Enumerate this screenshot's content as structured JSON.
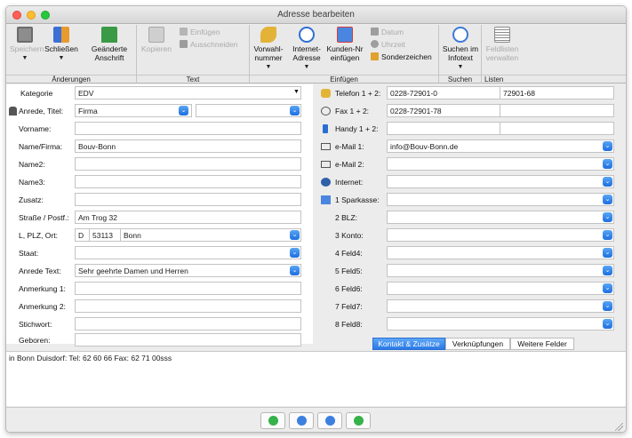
{
  "window": {
    "title": "Adresse bearbeiten"
  },
  "toolbar": {
    "groups": {
      "aenderungen": "Änderungen",
      "text": "Text",
      "einfuegen": "Einfügen",
      "suchen": "Suchen",
      "listen": "Listen"
    },
    "speichern": "Speichern",
    "schliessen": "Schließen",
    "geaenderte_anschrift_1": "Geänderte",
    "geaenderte_anschrift_2": "Anschrift",
    "kopieren": "Kopieren",
    "einfuegen_small": "Einfügen",
    "ausschneiden": "Ausschneiden",
    "vorwahlnummer_1": "Vorwahl-",
    "vorwahlnummer_2": "nummer",
    "internet_adresse_1": "Internet-",
    "internet_adresse_2": "Adresse",
    "kunden_nr_1": "Kunden-Nr",
    "kunden_nr_2": "einfügen",
    "datum": "Datum",
    "uhrzeit": "Uhrzeit",
    "sonderzeichen": "Sonderzeichen",
    "suchen_infotext_1": "Suchen im",
    "suchen_infotext_2": "Infotext",
    "feldlisten_1": "Feldlisten",
    "feldlisten_2": "verwalten"
  },
  "form": {
    "kategorie": {
      "label": "Kategorie",
      "value": "EDV"
    },
    "anrede": {
      "label": "Anrede, Titel:",
      "value": "Firma",
      "value2": ""
    },
    "vorname": {
      "label": "Vorname:",
      "value": ""
    },
    "name_firma": {
      "label": "Name/Firma:",
      "value": "Bouv-Bonn"
    },
    "name2": {
      "label": "Name2:",
      "value": ""
    },
    "name3": {
      "label": "Name3:",
      "value": ""
    },
    "zusatz": {
      "label": "Zusatz:",
      "value": ""
    },
    "strasse": {
      "label": "Straße / Postf.:",
      "value": "Am Trog 32"
    },
    "plz_ort": {
      "label": "L, PLZ, Ort:",
      "land": "D",
      "plz": "53113",
      "ort": "Bonn"
    },
    "staat": {
      "label": "Staat:",
      "value": ""
    },
    "anrede_text": {
      "label": "Anrede Text:",
      "value": "Sehr geehrte Damen und Herren"
    },
    "anmerkung1": {
      "label": "Anmerkung 1:",
      "value": ""
    },
    "anmerkung2": {
      "label": "Anmerkung 2:",
      "value": ""
    },
    "stichwort": {
      "label": "Stichwort:",
      "value": ""
    },
    "geboren": {
      "label": "Geboren:",
      "value": ""
    }
  },
  "contact": {
    "telefon": {
      "label": "Telefon 1 + 2:",
      "value1": "0228-72901-0",
      "value2": "72901-68"
    },
    "fax": {
      "label": "Fax 1 + 2:",
      "value1": "0228-72901-78",
      "value2": ""
    },
    "handy": {
      "label": "Handy 1 + 2:",
      "value1": "",
      "value2": ""
    },
    "email1": {
      "label": "e-Mail 1:",
      "value": "info@Bouv-Bonn.de"
    },
    "email2": {
      "label": "e-Mail 2:",
      "value": ""
    },
    "internet": {
      "label": "Internet:",
      "value": ""
    },
    "sparkasse": {
      "label": "1 Sparkasse:",
      "value": ""
    },
    "blz": {
      "label": "2 BLZ:",
      "value": ""
    },
    "konto": {
      "label": "3 Konto:",
      "value": ""
    },
    "feld4": {
      "label": "4 Feld4:",
      "value": ""
    },
    "feld5": {
      "label": "5 Feld5:",
      "value": ""
    },
    "feld6": {
      "label": "6 Feld6:",
      "value": ""
    },
    "feld7": {
      "label": "7 Feld7:",
      "value": ""
    },
    "feld8": {
      "label": "8 Feld8:",
      "value": ""
    }
  },
  "tabs": [
    "Kontakt & Zusätze",
    "Verknüpfungen",
    "Weitere Felder"
  ],
  "notes": {
    "text": "in Bonn Duisdorf: Tel: 62 60 66 Fax: 62 71 00sss"
  },
  "colors": {
    "accent": "#2a79e6",
    "nav_green": "#35b24a",
    "nav_blue": "#3b7fe0"
  }
}
